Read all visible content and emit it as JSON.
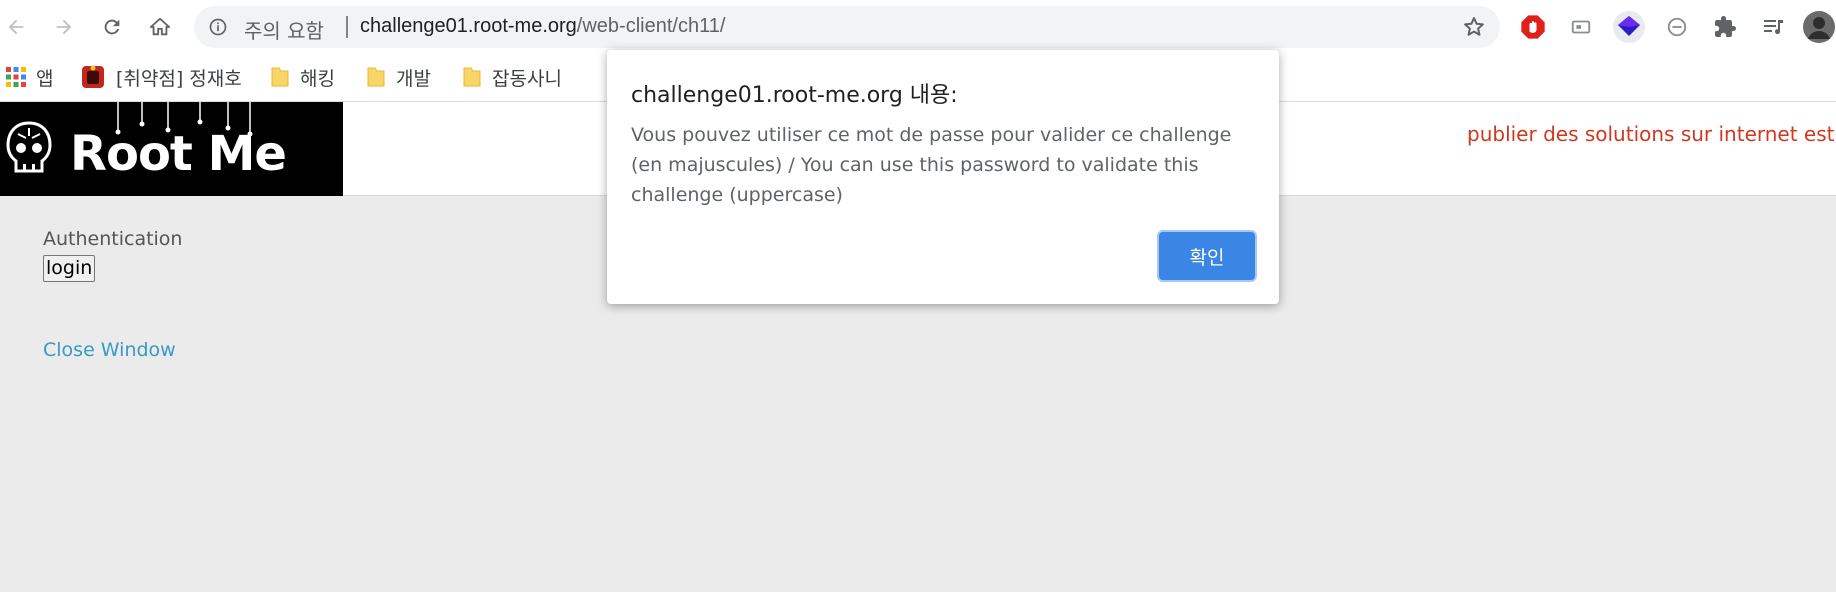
{
  "browser": {
    "security_label": "주의 요함",
    "url_host": "challenge01.root-me.org",
    "url_path": "/web-client/ch11/",
    "nav_icons": [
      "back-arrow-icon",
      "forward-arrow-icon",
      "reload-icon",
      "home-icon"
    ],
    "extension_icons": [
      "adblock-icon",
      "media-icon",
      "extension-cube-icon",
      "block-icon",
      "puzzle-extensions-icon",
      "media-queue-icon",
      "profile-avatar"
    ]
  },
  "bookmarks": {
    "items": [
      {
        "label": "앱",
        "icon": "apps-grid-icon"
      },
      {
        "label": "[취약점] 정재호",
        "icon": "bookmark-favicon"
      },
      {
        "label": "해킹",
        "icon": "folder-icon"
      },
      {
        "label": "개발",
        "icon": "folder-icon"
      },
      {
        "label": "잡동사니",
        "icon": "folder-icon"
      }
    ]
  },
  "page": {
    "logo_text": "Root Me",
    "warning_text": "publier des solutions sur internet est inte",
    "auth_label": "Authentication",
    "login_button": "login",
    "close_link": "Close Window"
  },
  "dialog": {
    "title": "challenge01.root-me.org 내용:",
    "message": "Vous pouvez utiliser ce mot de passe pour valider ce challenge (en majuscules) / You can use this password to validate this challenge (uppercase)",
    "ok_label": "확인"
  },
  "colors": {
    "ok_button": "#3b85e4",
    "warning_text": "#d0391f",
    "link": "#3799c8",
    "page_background": "#ebebeb"
  }
}
